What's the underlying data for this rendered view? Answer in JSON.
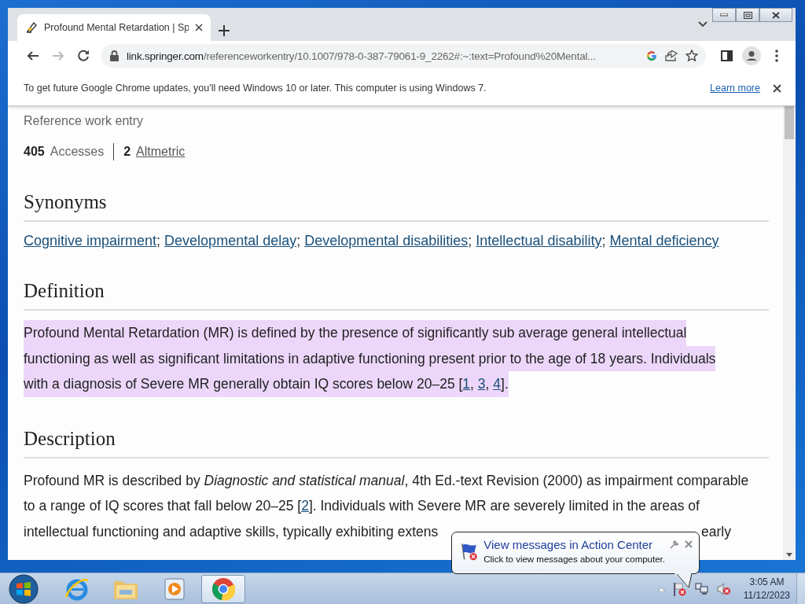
{
  "browser": {
    "tabs": [
      {
        "title": "Profound Mental Retardation | Sp",
        "selected": true
      }
    ],
    "address": {
      "host": "link.springer.com",
      "path": "/referenceworkentry/10.1007/978-0-387-79061-9_2262#:~:text=Profound%20Mental..."
    },
    "infobar": {
      "message": "To get future Google Chrome updates, you'll need Windows 10 or later. This computer is using Windows 7.",
      "link": "Learn more"
    }
  },
  "article": {
    "entry_type": "Reference work entry",
    "metrics": [
      {
        "count": "405",
        "name": "Accesses",
        "kind": "text"
      },
      {
        "count": "2",
        "name": "Altmetric",
        "kind": "link"
      }
    ],
    "sections": [
      {
        "heading": "Synonyms",
        "kind": "links",
        "links": [
          {
            "kind": "link",
            "text": "Cognitive impairment"
          },
          {
            "kind": "text",
            "text": "; "
          },
          {
            "kind": "link",
            "text": "Developmental delay"
          },
          {
            "kind": "text",
            "text": "; "
          },
          {
            "kind": "link",
            "text": "Developmental disabilities"
          },
          {
            "kind": "text",
            "text": "; "
          },
          {
            "kind": "link",
            "text": "Intellectual disability"
          },
          {
            "kind": "text",
            "text": "; "
          },
          {
            "kind": "link",
            "text": "Mental deficiency"
          }
        ]
      },
      {
        "heading": "Definition",
        "kind": "highlighted",
        "lines": [
          [
            {
              "kind": "text",
              "text": "Profound Mental Retardation (MR) is defined by the presence of significantly sub average general intellectual"
            }
          ],
          [
            {
              "kind": "text",
              "text": "functioning as well as significant limitations in adaptive functioning present prior to the age of 18 years. Individuals"
            }
          ],
          [
            {
              "kind": "text",
              "text": "with a diagnosis of Severe MR generally obtain IQ scores below 20–25 ["
            },
            {
              "kind": "link",
              "text": "1"
            },
            {
              "kind": "text",
              "text": ", "
            },
            {
              "kind": "link",
              "text": "3"
            },
            {
              "kind": "text",
              "text": ", "
            },
            {
              "kind": "link",
              "text": "4"
            },
            {
              "kind": "text",
              "text": "]."
            }
          ]
        ]
      },
      {
        "heading": "Description",
        "kind": "plain",
        "lines": [
          [
            {
              "kind": "text",
              "text": "Profound MR is described by "
            },
            {
              "kind": "italic",
              "text": "Diagnostic and statistical manual"
            },
            {
              "kind": "text",
              "text": ", 4th Ed.-text Revision (2000) as impairment comparable"
            }
          ],
          [
            {
              "kind": "text",
              "text": "to a range of IQ scores that fall below 20–25 ["
            },
            {
              "kind": "link",
              "text": "2"
            },
            {
              "kind": "text",
              "text": "]. Individuals with Severe MR are severely limited in the areas of"
            }
          ],
          [
            {
              "kind": "text",
              "text": "intellectual functioning and adaptive skills, typically exhibiting extens"
            },
            {
              "kind": "after_overlay",
              "text": "early"
            }
          ]
        ]
      }
    ]
  },
  "taskbar": {
    "apps": [
      {
        "kind": "browser-e",
        "selected": false
      },
      {
        "kind": "folder",
        "selected": false
      },
      {
        "kind": "media",
        "selected": false
      },
      {
        "kind": "chrome",
        "selected": true
      }
    ],
    "clock": {
      "time": "3:05 AM",
      "date": "11/12/2023"
    }
  },
  "balloon": {
    "title": "View messages in Action Center",
    "message": "Click to view messages about your computer."
  }
}
